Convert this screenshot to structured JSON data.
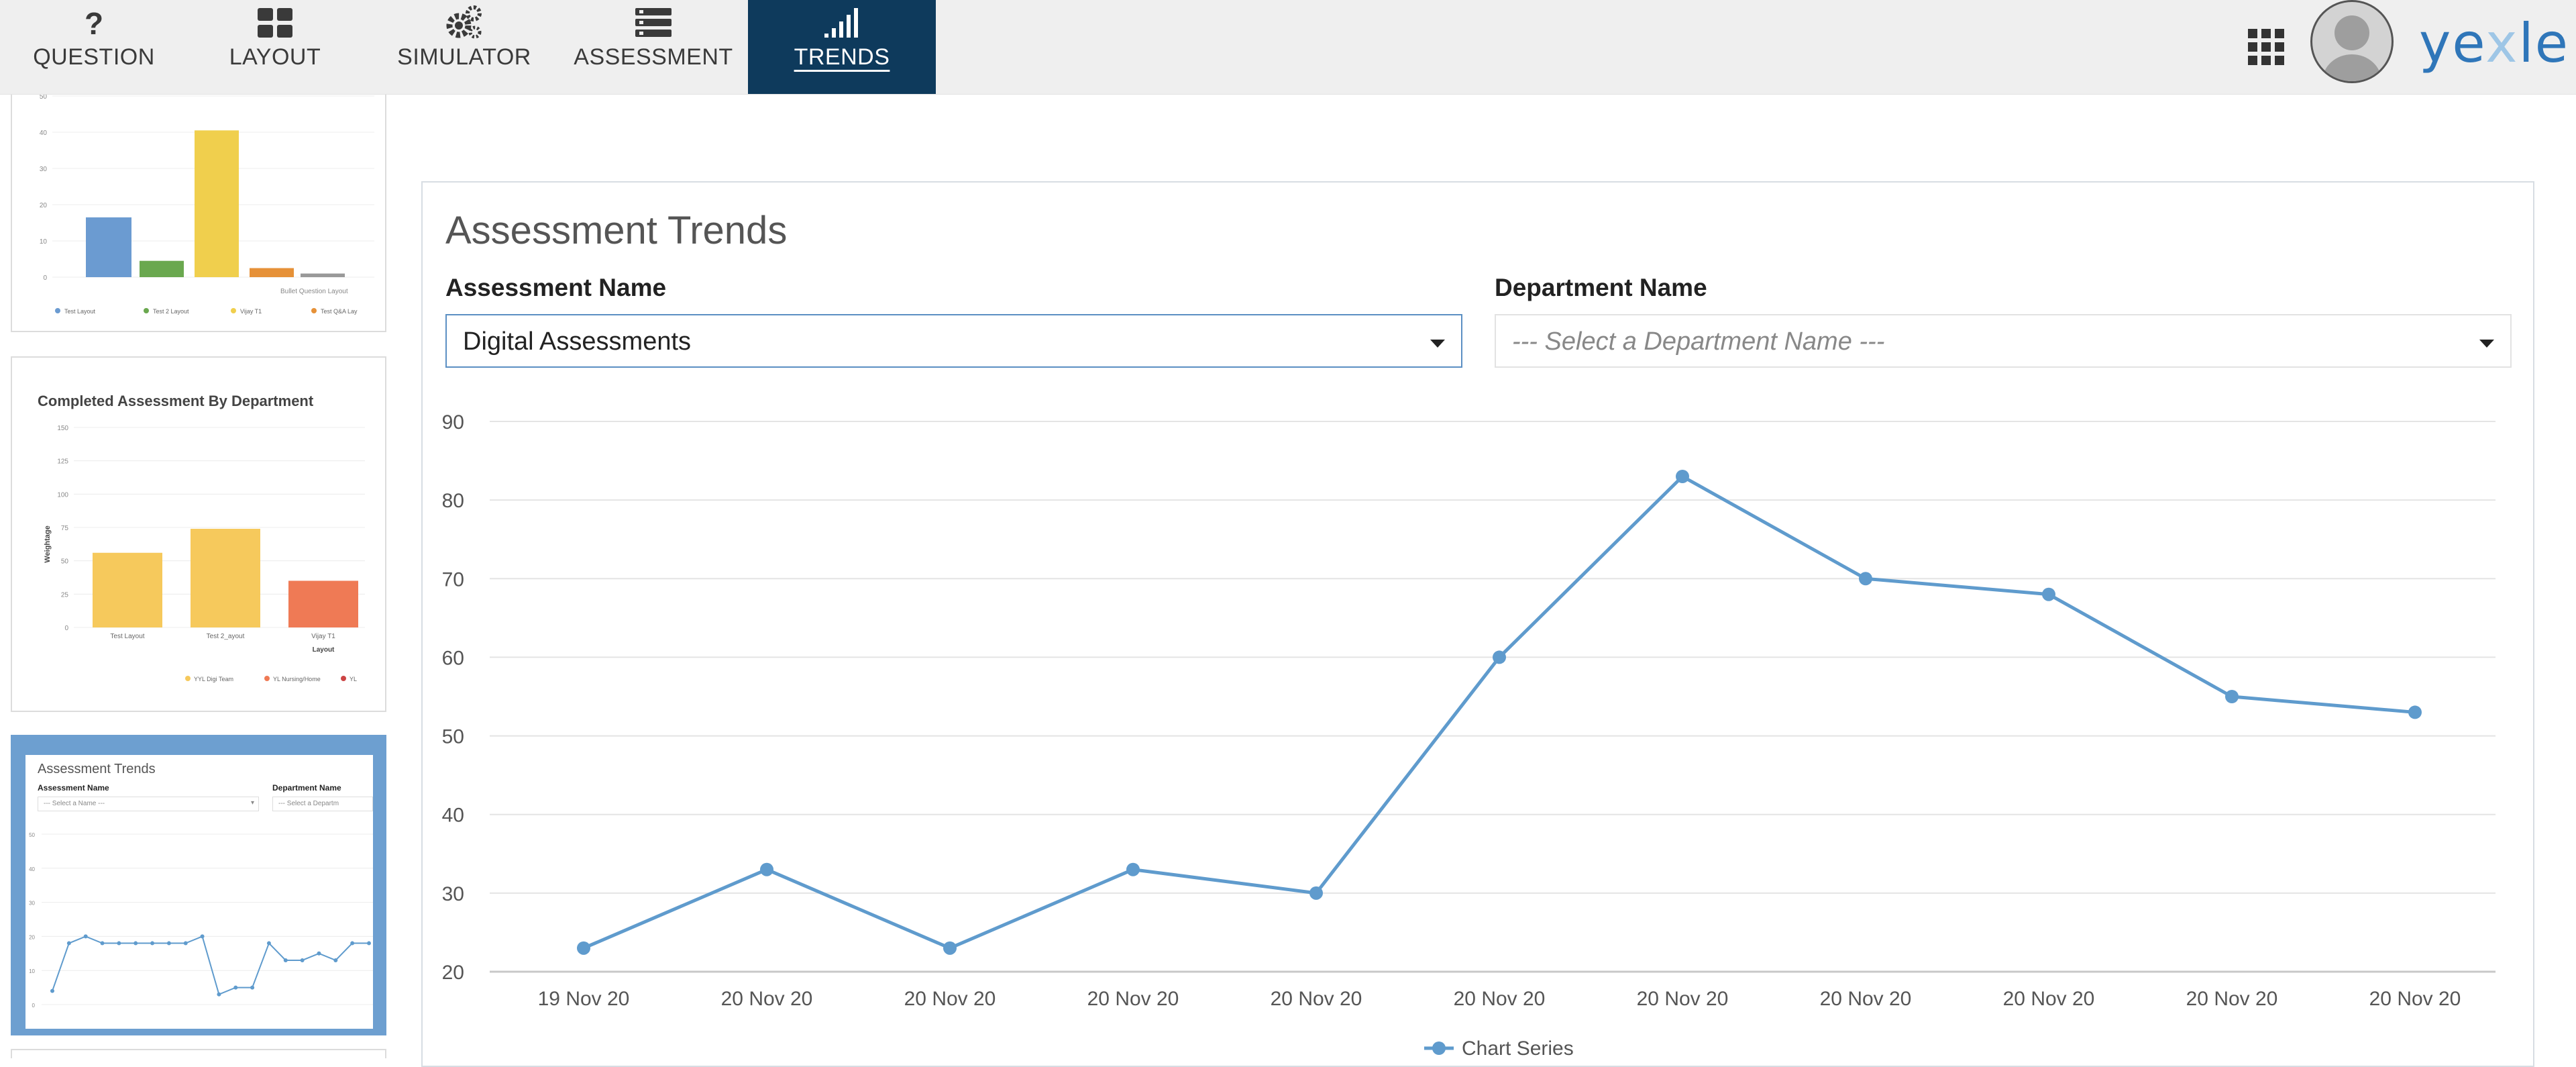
{
  "nav": {
    "tabs": [
      {
        "label": "QUESTION",
        "icon": "question-icon"
      },
      {
        "label": "LAYOUT",
        "icon": "layout-grid-icon"
      },
      {
        "label": "SIMULATOR",
        "icon": "gears-icon"
      },
      {
        "label": "ASSESSMENT",
        "icon": "assessment-list-icon"
      },
      {
        "label": "TRENDS",
        "icon": "signal-bars-icon",
        "active": true
      }
    ],
    "apps_icon": "apps-grid-icon",
    "avatar_icon": "user-avatar-icon"
  },
  "brand": {
    "logo_text_a": "ye",
    "logo_text_x": "x",
    "logo_text_b": "le",
    "color": "#2f76b9"
  },
  "sidebar": {
    "thumb1": {
      "y_ticks": [
        "50",
        "40",
        "30",
        "20",
        "10",
        "0"
      ],
      "legend": [
        "Test Layout",
        "Test 2 Layout",
        "Vijay T1",
        "Test Q&A Lay"
      ],
      "note": "Bullet Question Layout",
      "values": [
        16.5,
        4.5,
        40.5,
        2.5,
        1
      ],
      "colors": [
        "#6b9bd1",
        "#6aa84f",
        "#f0cf4d",
        "#e69138",
        "#999999"
      ]
    },
    "thumb2": {
      "title": "Completed Assessment By Department",
      "y_ticks": [
        "150",
        "125",
        "100",
        "75",
        "50",
        "25",
        "0"
      ],
      "ylabel": "Weightage",
      "xlabel": "Layout",
      "categories": [
        "Test Layout",
        "Test 2_ayout",
        "Vijay T1"
      ],
      "values": [
        56,
        74,
        35
      ],
      "colors": [
        "#f6c95c",
        "#f6c95c",
        "#ef7a55"
      ],
      "legend": [
        "YYL Digi Team",
        "YL Nursing/Home",
        "YL"
      ]
    },
    "thumb3": {
      "title": "Assessment Trends",
      "label_a": "Assessment Name",
      "label_b": "Department Name",
      "placeholder_a": "--- Select a Name ---",
      "placeholder_b": "--- Select a Departm",
      "y_ticks": [
        "50",
        "40",
        "30",
        "20",
        "10",
        "0"
      ],
      "values": [
        4,
        18,
        20,
        18,
        18,
        18,
        18,
        18,
        18,
        20,
        3,
        5,
        5,
        18,
        13,
        13,
        15,
        13,
        18,
        18
      ]
    }
  },
  "main": {
    "title": "Assessment Trends",
    "assessment_label": "Assessment Name",
    "assessment_value": "Digital Assessments",
    "department_label": "Department Name",
    "department_placeholder": "--- Select a Department Name ---"
  },
  "chart_data": {
    "type": "line",
    "x": [
      "19 Nov 20",
      "20 Nov 20",
      "20 Nov 20",
      "20 Nov 20",
      "20 Nov 20",
      "20 Nov 20",
      "20 Nov 20",
      "20 Nov 20",
      "20 Nov 20",
      "20 Nov 20",
      "20 Nov 20"
    ],
    "series": [
      {
        "name": "Chart Series",
        "values": [
          23,
          33,
          23,
          33,
          30,
          60,
          83,
          70,
          68,
          55,
          53
        ],
        "color": "#5f9bcd"
      }
    ],
    "title": "",
    "xlabel": "",
    "ylabel": "",
    "ylim": [
      20,
      90
    ],
    "y_ticks": [
      20,
      30,
      40,
      50,
      60,
      70,
      80,
      90
    ],
    "grid": true,
    "legend": "bottom-center"
  }
}
